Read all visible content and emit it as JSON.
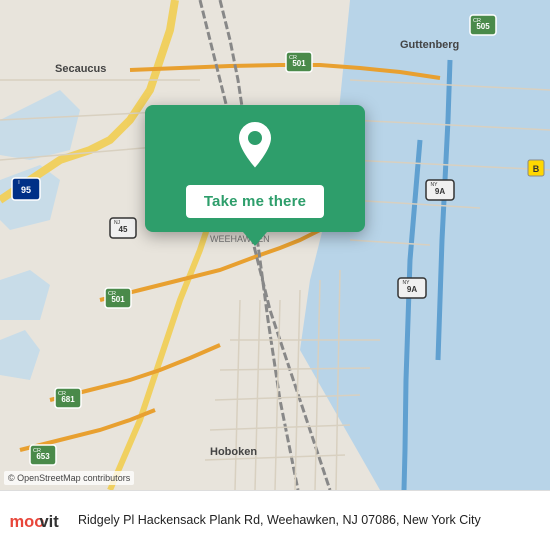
{
  "map": {
    "alt": "Map of Weehawken NJ area",
    "copyright": "© OpenStreetMap contributors"
  },
  "popup": {
    "button_label": "Take me there",
    "pin_color": "#ffffff"
  },
  "info_bar": {
    "address": "Ridgely Pl Hackensack Plank Rd, Weehawken, NJ 07086, New York City"
  },
  "logo": {
    "brand": "moovit",
    "color_m": "#e8463a",
    "color_text": "#333333"
  }
}
